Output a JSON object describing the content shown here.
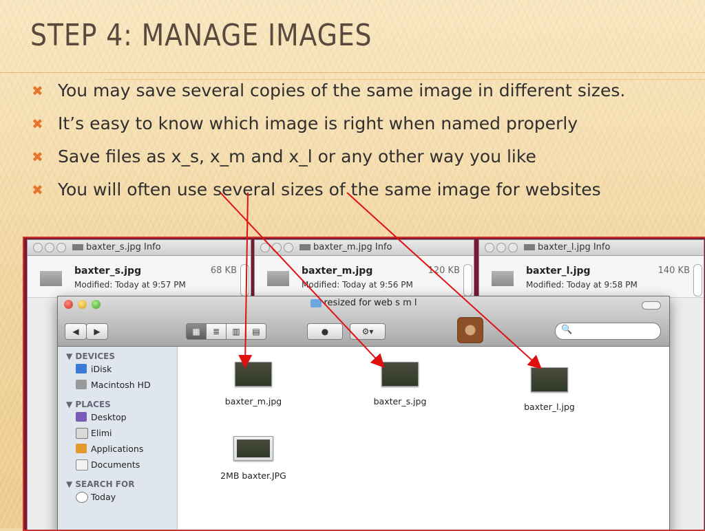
{
  "slide": {
    "title": "STEP 4: MANAGE IMAGES",
    "bullet_mark": "✖",
    "bullets": [
      "You may save several copies of the same image in different sizes.",
      "It’s easy to know which image is right when named properly",
      "Save files as x_s, x_m and x_l or any other way you like",
      "You will often use several sizes of the same image for websites"
    ]
  },
  "info_windows": [
    {
      "title": "baxter_s.jpg Info",
      "file": "baxter_s.jpg",
      "size": "68 KB",
      "modified": "Modified: Today at 9:57 PM"
    },
    {
      "title": "baxter_m.jpg Info",
      "file": "baxter_m.jpg",
      "size": "120 KB",
      "modified": "Modified: Today at 9:56 PM"
    },
    {
      "title": "baxter_l.jpg Info",
      "file": "baxter_l.jpg",
      "size": "140 KB",
      "modified": "Modified: Today at 9:58 PM"
    }
  ],
  "finder": {
    "title": "resized for web s m l",
    "nav_back": "◀",
    "nav_fwd": "▶",
    "search_icon": "🔍",
    "sidebar": {
      "devices_label": "▼ DEVICES",
      "devices": [
        "iDisk",
        "Macintosh HD"
      ],
      "places_label": "▼ PLACES",
      "places": [
        "Desktop",
        "Elimi",
        "Applications",
        "Documents"
      ],
      "search_label": "▼ SEARCH FOR",
      "search": [
        "Today"
      ]
    },
    "files": [
      {
        "name": "baxter_m.jpg"
      },
      {
        "name": "baxter_s.jpg"
      },
      {
        "name": "baxter_l.jpg"
      },
      {
        "name": "2MB baxter.JPG"
      }
    ]
  },
  "colors": {
    "title": "#5a4a3e",
    "bullet_mark": "#e5762c",
    "arrow": "#e01010"
  }
}
